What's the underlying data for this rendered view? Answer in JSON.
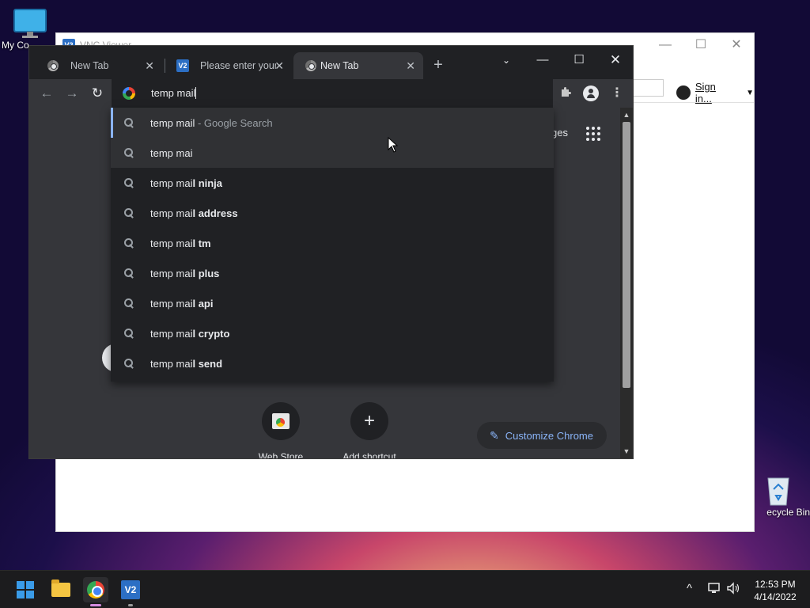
{
  "desktop": {
    "my_computer_label": "My Co",
    "recycle_bin_label": "ecycle Bin"
  },
  "vnc_window": {
    "title": "VNC Viewer",
    "sign_in_label": "Sign in..."
  },
  "chrome": {
    "tabs": [
      {
        "label": "New Tab",
        "favicon": "chrome-icon",
        "active": false
      },
      {
        "label": "Please enter your",
        "favicon": "vnc-icon",
        "active": false
      },
      {
        "label": "New Tab",
        "favicon": "chrome-icon",
        "active": true
      }
    ],
    "omnibox": {
      "text": "temp mail"
    },
    "suggestions": [
      {
        "typed": "temp mail",
        "bold": "",
        "suffix": " - Google Search"
      },
      {
        "typed": "temp mai",
        "bold": "",
        "suffix": ""
      },
      {
        "typed": "temp mai",
        "bold": "l ninja",
        "suffix": ""
      },
      {
        "typed": "temp mai",
        "bold": "l address",
        "suffix": ""
      },
      {
        "typed": "temp mai",
        "bold": "l tm",
        "suffix": ""
      },
      {
        "typed": "temp mai",
        "bold": "l plus",
        "suffix": ""
      },
      {
        "typed": "temp mai",
        "bold": "l api",
        "suffix": ""
      },
      {
        "typed": "temp mai",
        "bold": "l crypto",
        "suffix": ""
      },
      {
        "typed": "temp mai",
        "bold": "l send",
        "suffix": ""
      }
    ],
    "images_fragment": "ges",
    "shortcuts": [
      {
        "label": "Web Store"
      },
      {
        "label": "Add shortcut"
      }
    ],
    "customize_label": "Customize Chrome"
  },
  "taskbar": {
    "time": "12:53 PM",
    "date": "4/14/2022"
  },
  "colors": {
    "chrome_bg": "#202124",
    "chrome_toolbar": "#35363a",
    "accent_blue": "#8ab4f8",
    "windows_blue": "#3a9be8"
  }
}
